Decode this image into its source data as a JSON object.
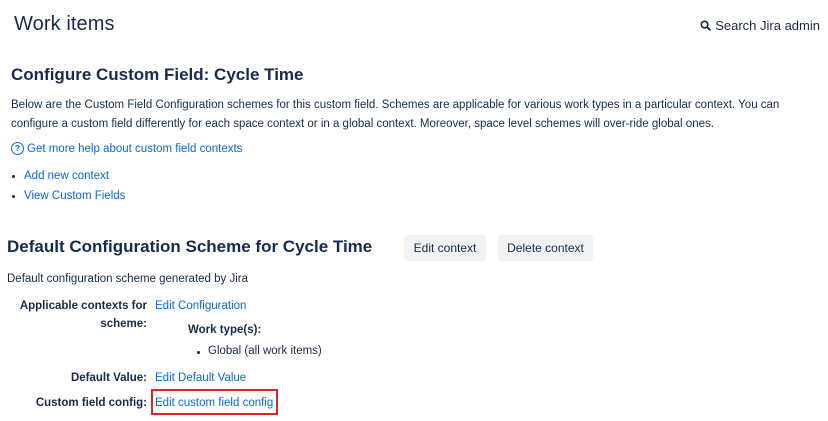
{
  "header": {
    "title": "Work items",
    "search_label": "Search Jira admin"
  },
  "section": {
    "title": "Configure Custom Field: Cycle Time",
    "description": "Below are the Custom Field Configuration schemes for this custom field. Schemes are applicable for various work types in a particular context. You can configure a custom field differently for each space context or in a global context. Moreover, space level schemes will over-ride global ones.",
    "help_link": "Get more help about custom field contexts",
    "actions": [
      "Add new context",
      "View Custom Fields"
    ]
  },
  "scheme": {
    "title": "Default Configuration Scheme for Cycle Time",
    "edit_context_label": "Edit context",
    "delete_context_label": "Delete context",
    "description": "Default configuration scheme generated by Jira",
    "applicable_label_line1": "Applicable contexts for",
    "applicable_label_line2": "scheme:",
    "edit_configuration": "Edit Configuration",
    "work_types_label": "Work type(s):",
    "work_types": [
      "Global (all work items)"
    ],
    "default_value_label": "Default Value:",
    "edit_default_value": "Edit Default Value",
    "custom_field_config_label": "Custom field config:",
    "edit_custom_field_config": "Edit custom field config"
  },
  "colors": {
    "link": "#0c66e4",
    "text": "#172b4d",
    "button_bg": "#f1f2f4",
    "highlight": "#d9262c"
  }
}
